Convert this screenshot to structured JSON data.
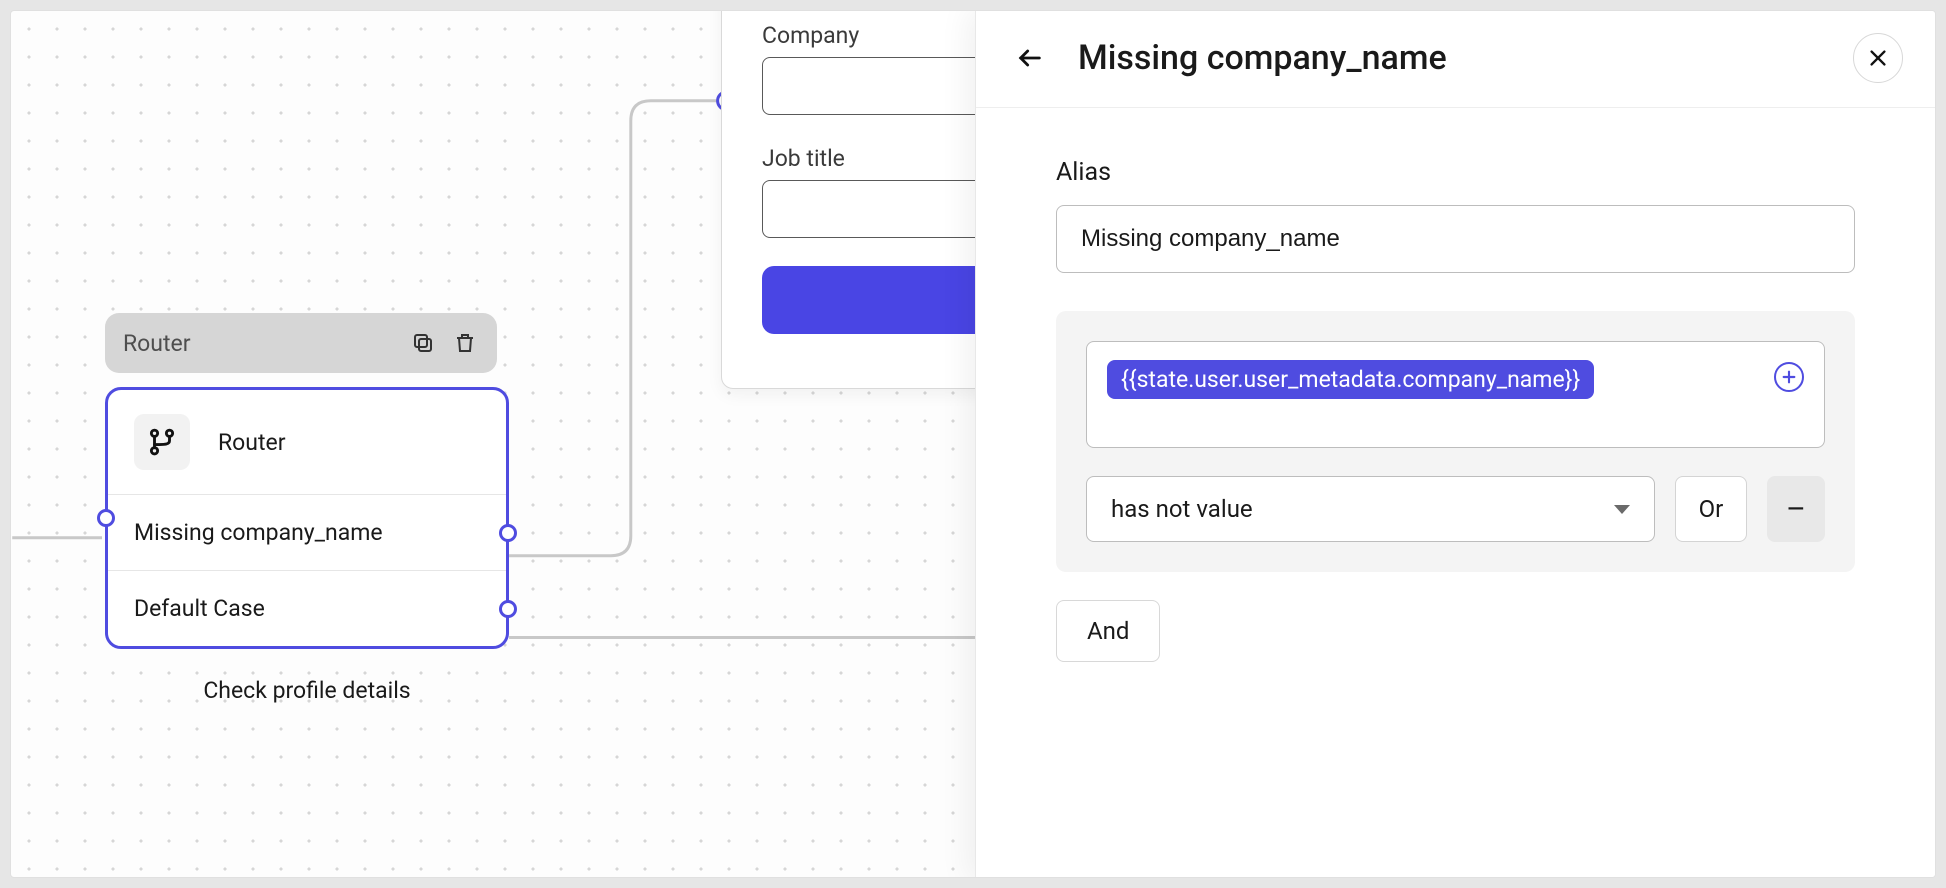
{
  "canvas": {
    "node": {
      "header_title": "Router",
      "rows": {
        "router": "Router",
        "case1": "Missing company_name",
        "default": "Default Case"
      },
      "caption": "Check profile details"
    },
    "bg_form": {
      "company_label": "Company",
      "job_label": "Job title"
    }
  },
  "panel": {
    "title": "Missing company_name",
    "alias_label": "Alias",
    "alias_value": "Missing company_name",
    "condition": {
      "expression": "{{state.user.user_metadata.company_name}}",
      "operator": "has not value",
      "or_label": "Or",
      "minus_label": "–"
    },
    "and_label": "And"
  }
}
